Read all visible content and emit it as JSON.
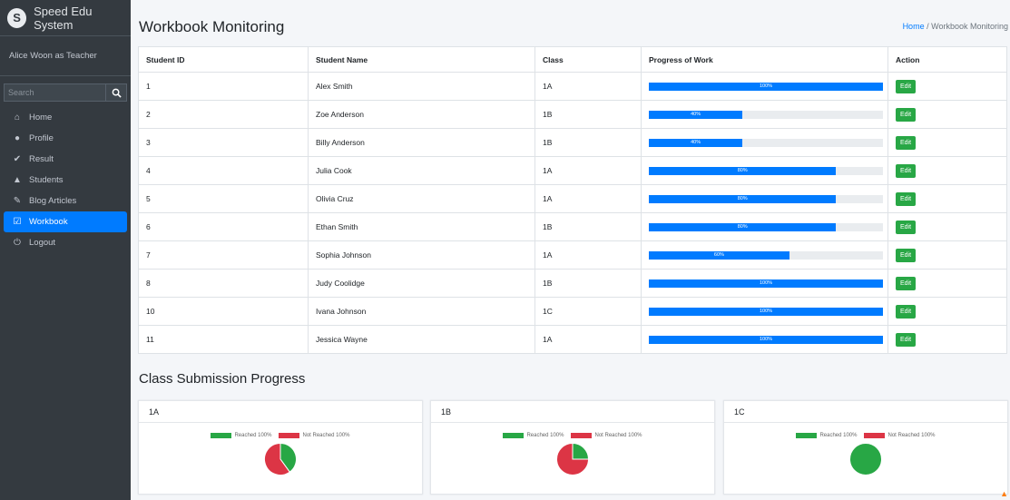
{
  "sidebar": {
    "brand": "Speed Edu System",
    "user": "Alice Woon as Teacher",
    "search_placeholder": "Search",
    "items": [
      {
        "label": "Home",
        "icon": "home-icon"
      },
      {
        "label": "Profile",
        "icon": "user-icon"
      },
      {
        "label": "Result",
        "icon": "check-icon"
      },
      {
        "label": "Students",
        "icon": "graduation-cap-icon"
      },
      {
        "label": "Blog Articles",
        "icon": "edit-icon"
      },
      {
        "label": "Workbook",
        "icon": "checkbox-icon",
        "active": true
      },
      {
        "label": "Logout",
        "icon": "power-icon"
      }
    ]
  },
  "header": {
    "title": "Workbook Monitoring",
    "breadcrumb_home": "Home",
    "breadcrumb_sep": "/",
    "breadcrumb_current": "Workbook Monitoring"
  },
  "table": {
    "headers": [
      "Student ID",
      "Student Name",
      "Class",
      "Progress of Work",
      "Action"
    ],
    "rows": [
      {
        "id": "1",
        "name": "Alex Smith",
        "class": "1A",
        "progress": 100,
        "progress_label": "100%",
        "action": "Edit"
      },
      {
        "id": "2",
        "name": "Zoe Anderson",
        "class": "1B",
        "progress": 40,
        "progress_label": "40%",
        "action": "Edit"
      },
      {
        "id": "3",
        "name": "Billy Anderson",
        "class": "1B",
        "progress": 40,
        "progress_label": "40%",
        "action": "Edit"
      },
      {
        "id": "4",
        "name": "Julia Cook",
        "class": "1A",
        "progress": 80,
        "progress_label": "80%",
        "action": "Edit"
      },
      {
        "id": "5",
        "name": "Olivia Cruz",
        "class": "1A",
        "progress": 80,
        "progress_label": "80%",
        "action": "Edit"
      },
      {
        "id": "6",
        "name": "Ethan Smith",
        "class": "1B",
        "progress": 80,
        "progress_label": "80%",
        "action": "Edit"
      },
      {
        "id": "7",
        "name": "Sophia Johnson",
        "class": "1A",
        "progress": 60,
        "progress_label": "60%",
        "action": "Edit"
      },
      {
        "id": "8",
        "name": "Judy Coolidge",
        "class": "1B",
        "progress": 100,
        "progress_label": "100%",
        "action": "Edit"
      },
      {
        "id": "10",
        "name": "Ivana Johnson",
        "class": "1C",
        "progress": 100,
        "progress_label": "100%",
        "action": "Edit"
      },
      {
        "id": "11",
        "name": "Jessica Wayne",
        "class": "1A",
        "progress": 100,
        "progress_label": "100%",
        "action": "Edit"
      }
    ]
  },
  "submission": {
    "title": "Class Submission Progress",
    "legend_reached": "Reached 100%",
    "legend_not_reached": "Not Reached 100%",
    "colors": {
      "reached": "#28a745",
      "not_reached": "#dc3545"
    },
    "classes": [
      {
        "name": "1A",
        "reached": 2,
        "not_reached": 3
      },
      {
        "name": "1B",
        "reached": 1,
        "not_reached": 3
      },
      {
        "name": "1C",
        "reached": 1,
        "not_reached": 0
      }
    ]
  },
  "colors": {
    "sidebar": "#343a40",
    "accent": "#007bff",
    "success": "#28a745",
    "danger": "#dc3545"
  }
}
